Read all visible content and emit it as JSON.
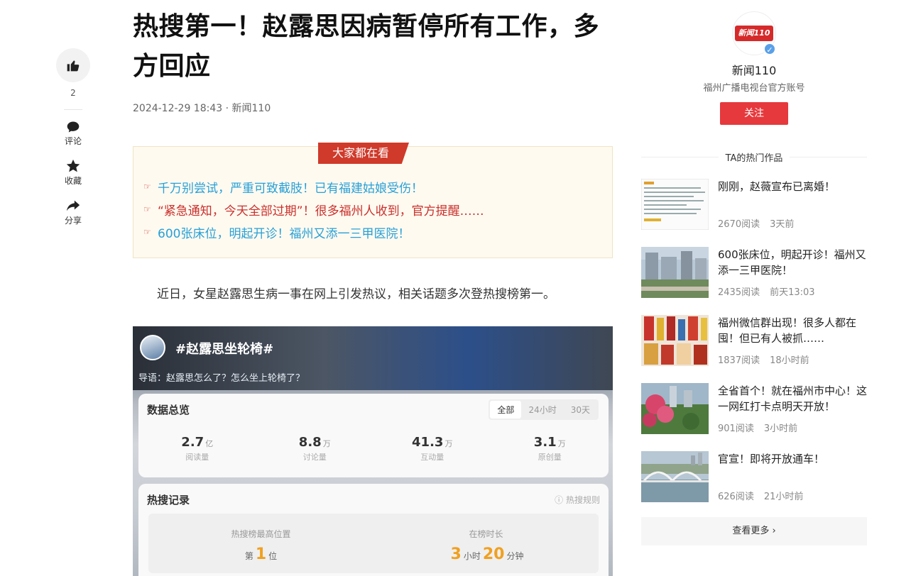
{
  "actions": {
    "like_count": "2",
    "comment_label": "评论",
    "collect_label": "收藏",
    "share_label": "分享"
  },
  "article": {
    "title": "热搜第一！赵露思因病暂停所有工作，多方回应",
    "meta": "2024-12-29 18:43 · 新闻110",
    "hot_tag": "大家都在看",
    "hot_items": [
      {
        "text": "千万别尝试，严重可致截肢！已有福建姑娘受伤！",
        "color": "#27a0d8"
      },
      {
        "text": "“紧急通知，今天全部过期”！很多福州人收到，官方提醒……",
        "color": "#c9302c"
      },
      {
        "text": "600张床位，明起开诊！福州又添一三甲医院！",
        "color": "#27a0d8"
      }
    ],
    "paragraph": "近日，女星赵露思生病一事在网上引发热议，相关话题多次登热搜榜第一。"
  },
  "image": {
    "topic": "#赵露思坐轮椅#",
    "guide": "导语：赵露思怎么了？怎么坐上轮椅了？",
    "overview_title": "数据总览",
    "tabs": [
      "全部",
      "24小时",
      "30天"
    ],
    "stats": [
      {
        "value": "2.7",
        "unit": "亿",
        "label": "阅读量"
      },
      {
        "value": "8.8",
        "unit": "万",
        "label": "讨论量"
      },
      {
        "value": "41.3",
        "unit": "万",
        "label": "互动量"
      },
      {
        "value": "3.1",
        "unit": "万",
        "label": "原创量"
      }
    ],
    "record_title": "热搜记录",
    "rule_label": "ⓘ 热搜规则",
    "rank_label": "热搜榜最高位置",
    "rank_prefix": "第",
    "rank_value": "1",
    "rank_suffix": "位",
    "duration_label": "在榜时长",
    "duration_hours": "3",
    "duration_h_unit": "小时",
    "duration_minutes": "20",
    "duration_m_unit": "分钟"
  },
  "sidebar": {
    "logo_text": "新闻110",
    "author_name": "新闻110",
    "author_desc": "福州广播电视台官方账号",
    "follow_label": "关注",
    "works_heading": "TA的热门作品",
    "works": [
      {
        "title": "刚刚，赵薇宣布已离婚！",
        "reads": "2670阅读",
        "time": "3天前",
        "thumb": "document-thumb"
      },
      {
        "title": "600张床位，明起开诊！福州又添一三甲医院！",
        "reads": "2435阅读",
        "time": "前天13:03",
        "thumb": "hospital-thumb"
      },
      {
        "title": "福州微信群出现！很多人都在囤！但已有人被抓……",
        "reads": "1837阅读",
        "time": "18小时前",
        "thumb": "fireworks-thumb"
      },
      {
        "title": "全省首个！就在福州市中心！这一网红打卡点明天开放！",
        "reads": "901阅读",
        "time": "3小时前",
        "thumb": "flowers-thumb"
      },
      {
        "title": "官宣！即将开放通车！",
        "reads": "626阅读",
        "time": "21小时前",
        "thumb": "bridge-thumb"
      }
    ],
    "more_label": "查看更多 ›"
  }
}
